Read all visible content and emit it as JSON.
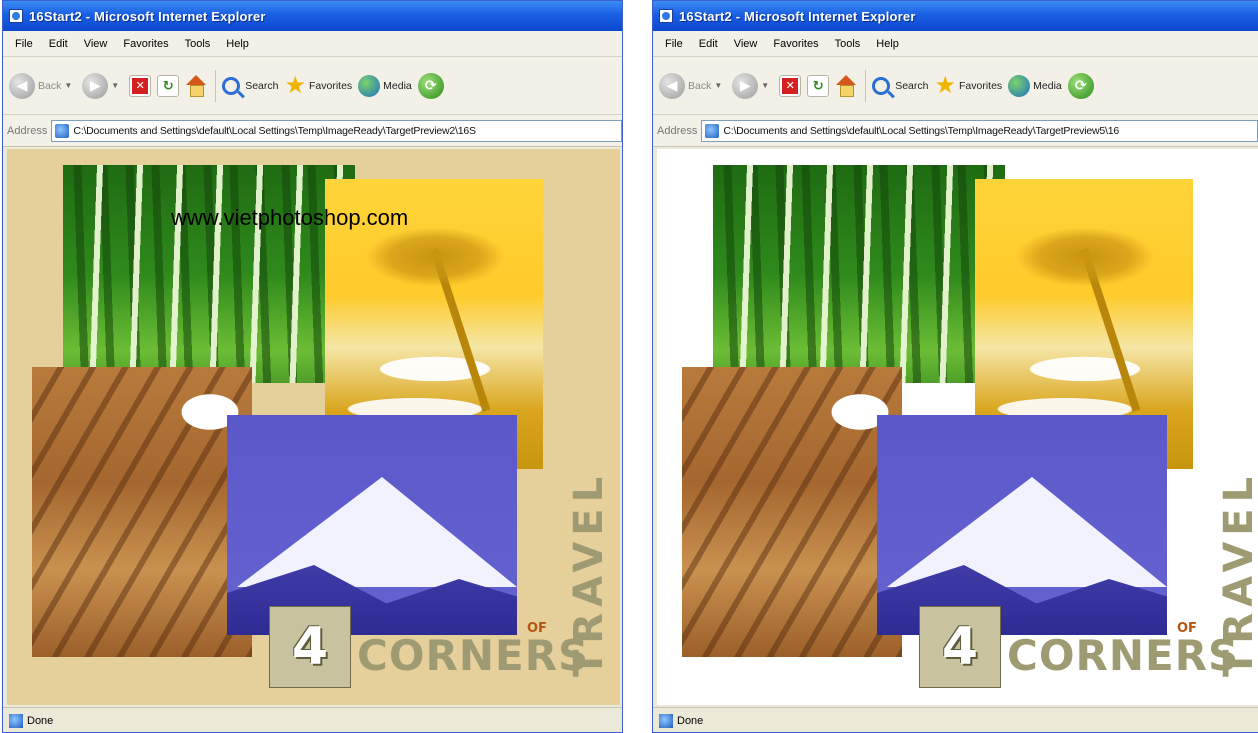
{
  "windows": [
    {
      "title": "16Start2 - Microsoft Internet Explorer",
      "menu": [
        "File",
        "Edit",
        "View",
        "Favorites",
        "Tools",
        "Help"
      ],
      "toolbar": {
        "back": "Back",
        "search": "Search",
        "favorites": "Favorites",
        "media": "Media"
      },
      "address_label": "Address",
      "address_url": "C:\\Documents and Settings\\default\\Local Settings\\Temp\\ImageReady\\TargetPreview2\\16S",
      "status": "Done",
      "content_bg": "#e5cf9a",
      "watermark": "www.vietphotoshop.com",
      "logo": {
        "number": "4",
        "of": "OF",
        "corners": "CORNERS",
        "travel": "TRAVEL"
      }
    },
    {
      "title": "16Start2 - Microsoft Internet Explorer",
      "menu": [
        "File",
        "Edit",
        "View",
        "Favorites",
        "Tools",
        "Help"
      ],
      "toolbar": {
        "back": "Back",
        "search": "Search",
        "favorites": "Favorites",
        "media": "Media"
      },
      "address_label": "Address",
      "address_url": "C:\\Documents and Settings\\default\\Local Settings\\Temp\\ImageReady\\TargetPreview5\\16",
      "status": "Done",
      "content_bg": "#ffffff",
      "logo": {
        "number": "4",
        "of": "OF",
        "corners": "CORNERS",
        "travel": "TRAVEL"
      }
    }
  ],
  "icons": {
    "back": "back-arrow-icon",
    "forward": "forward-arrow-icon",
    "stop": "stop-icon",
    "refresh": "refresh-icon",
    "home": "home-icon",
    "search": "search-icon",
    "favorites": "star-icon",
    "media": "media-globe-icon",
    "history": "history-icon"
  }
}
